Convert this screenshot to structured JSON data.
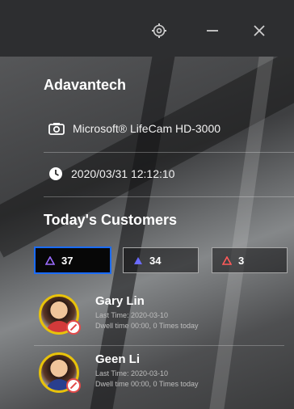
{
  "window": {
    "controls": {
      "settings_icon": "gear-icon",
      "minimize_icon": "minus-icon",
      "close_icon": "close-icon"
    }
  },
  "brand": {
    "name": "Adavantech"
  },
  "camera": {
    "icon": "camera-icon",
    "label": "Microsoft® LifeCam HD-3000"
  },
  "clock": {
    "icon": "clock-icon",
    "datetime": "2020/03/31 12:12:10"
  },
  "customers_section": {
    "title": "Today's Customers",
    "counters": [
      {
        "value": "37",
        "icon": "triangle-alert-icon",
        "color": "#9b6cff",
        "selected": true
      },
      {
        "value": "34",
        "icon": "triangle-alert-icon",
        "color": "#6b6bff"
      },
      {
        "value": "3",
        "icon": "triangle-alert-icon",
        "color": "#ff5a5a"
      }
    ]
  },
  "customers": [
    {
      "name": "Gary Lin",
      "last_time": "Last Time: 2020-03-10",
      "dwell": "Dwell time 00:00, 0 Times today"
    },
    {
      "name": "Geen Li",
      "last_time": "Last Time: 2020-03-10",
      "dwell": "Dwell time 00:00, 0 Times today"
    }
  ],
  "colors": {
    "accent_blue": "#1a6cff",
    "avatar_ring": "#e8c20a",
    "block_red": "#e24a4a"
  }
}
